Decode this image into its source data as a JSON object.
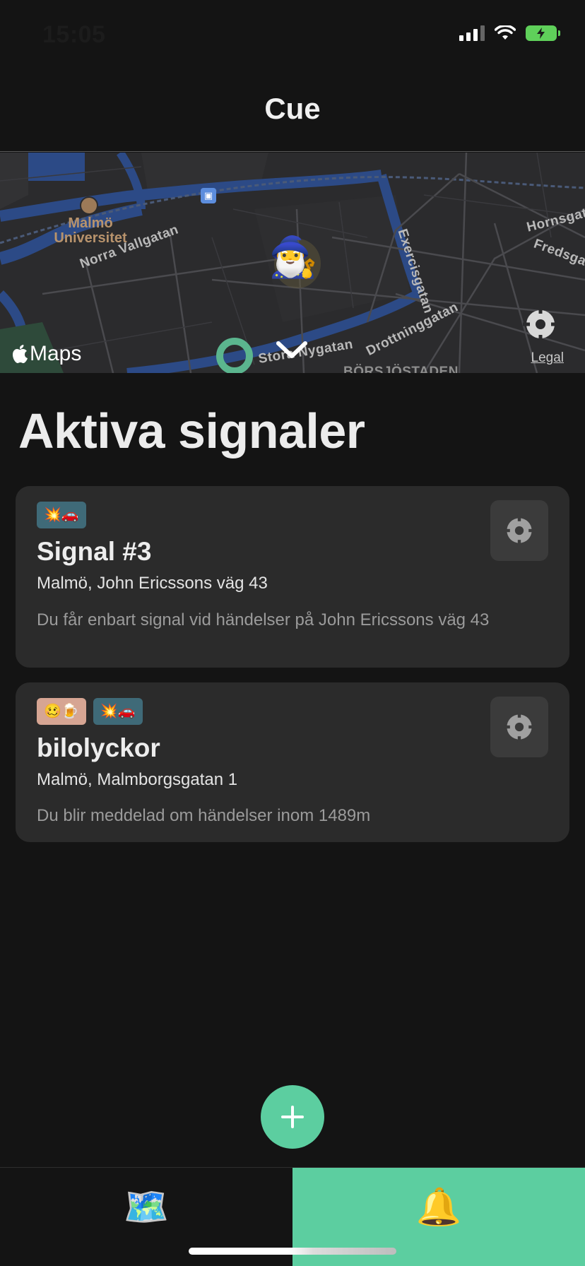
{
  "status_bar": {
    "time": "15:05"
  },
  "nav": {
    "title": "Cue"
  },
  "map": {
    "labels": {
      "university": "Malmö Universitet",
      "norra_vallgatan": "Norra Vallgatan",
      "exercisgatan": "Exercisgatan",
      "stora_nygatan": "Stora Nygatan",
      "drottninggatan": "Drottninggatan",
      "hornsgatan": "Hornsgat",
      "fredsgatan": "Fredsgat",
      "borsjostaden": "BÖRSJÖSTADEN"
    },
    "user_emoji": "🧙‍♂️",
    "maps_label": "Maps",
    "legal_label": "Legal"
  },
  "section": {
    "title": "Aktiva signaler"
  },
  "signals": [
    {
      "tags": [
        "💥🚗"
      ],
      "title": "Signal #3",
      "address": "Malmö, John Ericssons väg 43",
      "description": "Du får enbart signal vid händelser på John Ericssons väg 43"
    },
    {
      "tags": [
        "🥴🍺",
        "💥🚗"
      ],
      "title": "bilolyckor",
      "address": "Malmö, Malmborgsgatan 1",
      "description": "Du blir meddelad om händelser inom 1489m"
    }
  ],
  "tab_bar": {
    "map_tab_emoji": "🗺️",
    "alerts_tab_emoji": "🔔"
  },
  "colors": {
    "accent": "#5ccea0",
    "background": "#141414",
    "card": "#2b2b2b",
    "tag_teal": "#3f6a78",
    "tag_peach": "#d6a593"
  }
}
